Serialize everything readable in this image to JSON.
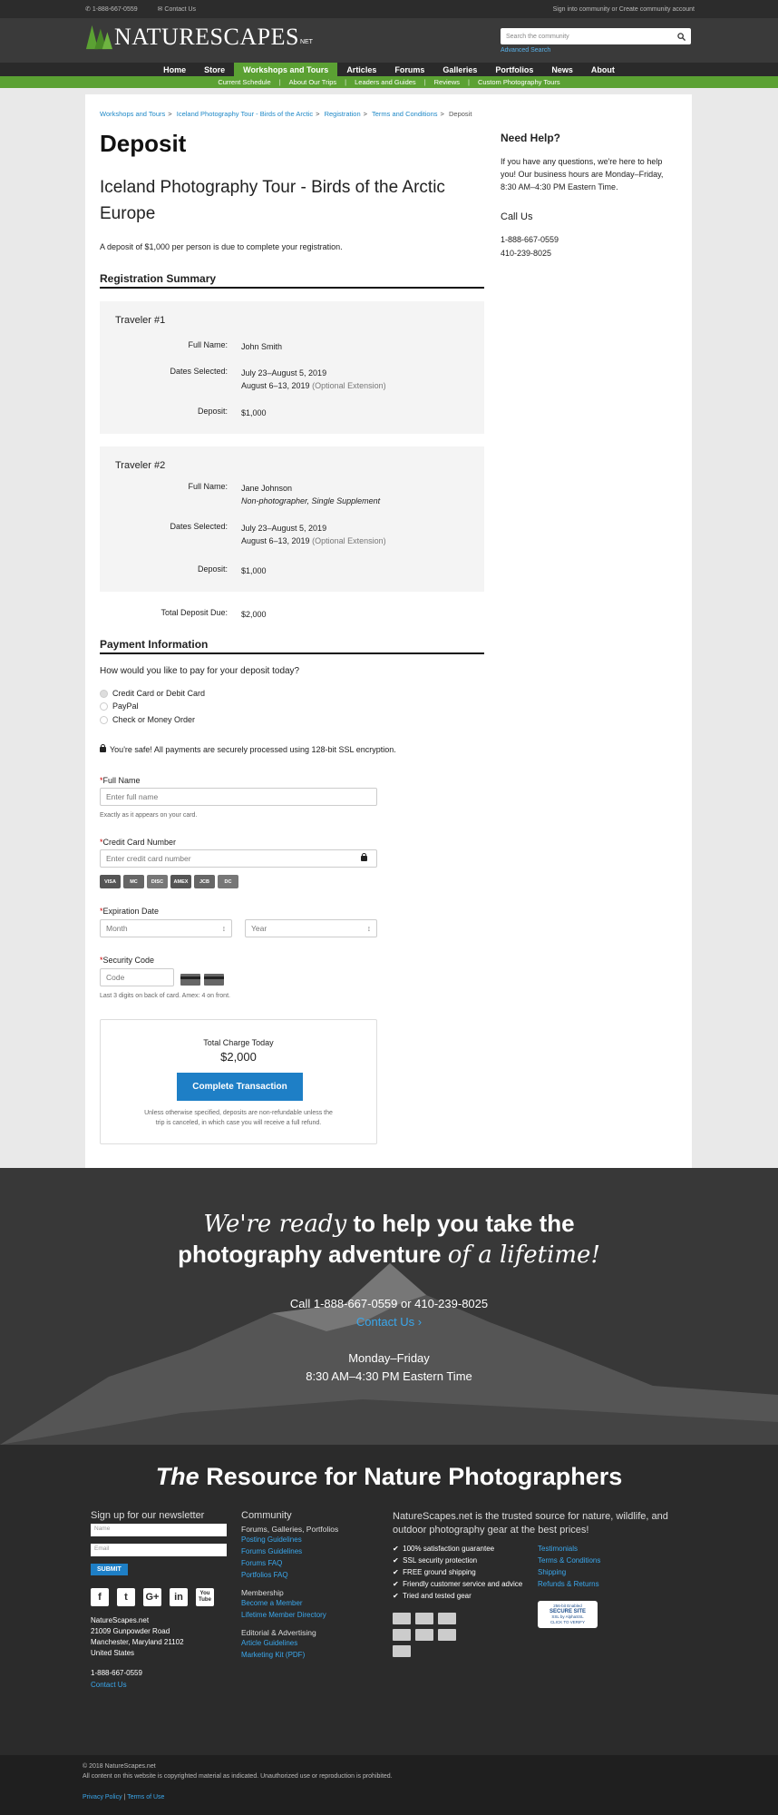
{
  "topbar": {
    "phone": "1-888-667-0559",
    "contact": "Contact Us",
    "sign_in": "Sign into community",
    "or": "or",
    "create": "Create community account"
  },
  "header": {
    "logo_text": "NATURESCAPES",
    "logo_suffix": "NET",
    "search_placeholder": "Search the community",
    "advanced_search": "Advanced Search"
  },
  "nav": [
    "Home",
    "Store",
    "Workshops and Tours",
    "Articles",
    "Forums",
    "Galleries",
    "Portfolios",
    "News",
    "About"
  ],
  "subnav": [
    "Current Schedule",
    "About Our Trips",
    "Leaders and Guides",
    "Reviews",
    "Custom Photography Tours"
  ],
  "breadcrumb": {
    "items": [
      "Workshops and Tours",
      "Iceland Photography Tour - Birds of the Arctic",
      "Registration",
      "Terms and Conditions"
    ],
    "current": "Deposit"
  },
  "page": {
    "title": "Deposit",
    "tour_title": "Iceland Photography Tour - Birds of the Arctic Europe",
    "intro": "A deposit of $1,000 per person is due to complete your registration.",
    "summary_heading": "Registration Summary",
    "travelers": [
      {
        "name_label": "Traveler #1",
        "full_name_label": "Full Name:",
        "full_name": "John Smith",
        "note": "",
        "dates_label": "Dates Selected:",
        "date1": "July 23–August 5, 2019",
        "date2": "August 6–13, 2019",
        "date2_note": "(Optional Extension)",
        "deposit_label": "Deposit:",
        "deposit": "$1,000"
      },
      {
        "name_label": "Traveler #2",
        "full_name_label": "Full Name:",
        "full_name": "Jane Johnson",
        "note": "Non-photographer, Single Supplement",
        "dates_label": "Dates Selected:",
        "date1": "July 23–August 5, 2019",
        "date2": "August 6–13, 2019",
        "date2_note": "(Optional Extension)",
        "deposit_label": "Deposit:",
        "deposit": "$1,000"
      }
    ],
    "total_label": "Total Deposit Due:",
    "total": "$2,000",
    "payment_heading": "Payment Information",
    "payment_question": "How would you like to pay for your deposit today?",
    "payment_options": [
      "Credit Card or Debit Card",
      "PayPal",
      "Check or Money Order"
    ],
    "selected_option": "Credit Card or Debit Card",
    "secure_note": "You're safe! All payments are securely processed using 128-bit SSL encryption.",
    "form": {
      "required_mark": "*",
      "full_name_label": "Full Name",
      "full_name_placeholder": "Enter full name",
      "full_name_help": "Exactly as it appears on your card.",
      "card_label": "Credit Card Number",
      "card_placeholder": "Enter credit card number",
      "card_brands": [
        "VISA",
        "MC",
        "DISC",
        "AMEX",
        "JCB",
        "DC"
      ],
      "exp_label": "Expiration Date",
      "month": "Month",
      "year": "Year",
      "cvv_label": "Security Code",
      "cvv_placeholder": "Code",
      "cvv_help": "Last 3 digits on back of card. Amex: 4 on front."
    },
    "charge_label": "Total Charge Today",
    "charge_amount": "$2,000",
    "submit_label": "Complete Transaction",
    "refund_note": "Unless otherwise specified, deposits are non-refundable unless the trip is canceled, in which case you will receive a full refund."
  },
  "aside": {
    "help_title": "Need Help?",
    "help_text": "If you have any questions, we're here to help you! Our business hours are Monday–Friday, 8:30 AM–4:30 PM Eastern Time.",
    "call_title": "Call Us",
    "phones": [
      "1-888-667-0559",
      "410-239-8025"
    ]
  },
  "cta": {
    "script1": "We're ready",
    "line1": "to help you take the",
    "line2": "photography adventure",
    "script2": "of a lifetime!",
    "call": "Call 1-888-667-0559 or 410-239-8025",
    "contact": "Contact Us ›",
    "days": "Monday–Friday",
    "hours": "8:30 AM–4:30 PM Eastern Time"
  },
  "footer": {
    "headline_the": "The",
    "headline": "Resource for Nature Photographers",
    "newsletter_title": "Sign up for our newsletter",
    "name_ph": "Name",
    "email_ph": "Email",
    "submit": "SUBMIT",
    "social": [
      "f",
      "t",
      "G+",
      "in",
      "You Tube"
    ],
    "address": [
      "NatureScapes.net",
      "21009 Gunpowder Road",
      "Manchester, Maryland 21102",
      "United States"
    ],
    "phone": "1-888-667-0559",
    "contact": "Contact Us",
    "community_title": "Community",
    "community_sub": "Forums, Galleries, Portfolios",
    "community_links": [
      "Posting Guidelines",
      "Forums Guidelines",
      "Forums FAQ",
      "Portfolios FAQ"
    ],
    "membership_title": "Membership",
    "membership_links": [
      "Become a Member",
      "Lifetime Member Directory"
    ],
    "editorial_title": "Editorial & Advertising",
    "editorial_links": [
      "Article Guidelines",
      "Marketing Kit (PDF)"
    ],
    "trust_text": "NatureScapes.net is the trusted source for nature, wildlife, and outdoor photography gear at the best prices!",
    "checks": [
      "100% satisfaction guarantee",
      "SSL security protection",
      "FREE ground shipping",
      "Friendly customer service and advice",
      "Tried and tested gear"
    ],
    "trust_links": [
      "Testimonials",
      "Terms & Conditions",
      "Shipping",
      "Refunds & Returns"
    ],
    "seal": [
      "256-bit Enabled",
      "SECURE SITE",
      "SSL by AlphaSSL",
      "CLICK TO VERIFY"
    ]
  },
  "bottom": {
    "copyright": "© 2018 NatureScapes.net",
    "rights": "All content on this website is copyrighted material as indicated. Unauthorized use or reproduction is prohibited.",
    "privacy": "Privacy Policy",
    "sep": "|",
    "terms": "Terms of Use"
  }
}
